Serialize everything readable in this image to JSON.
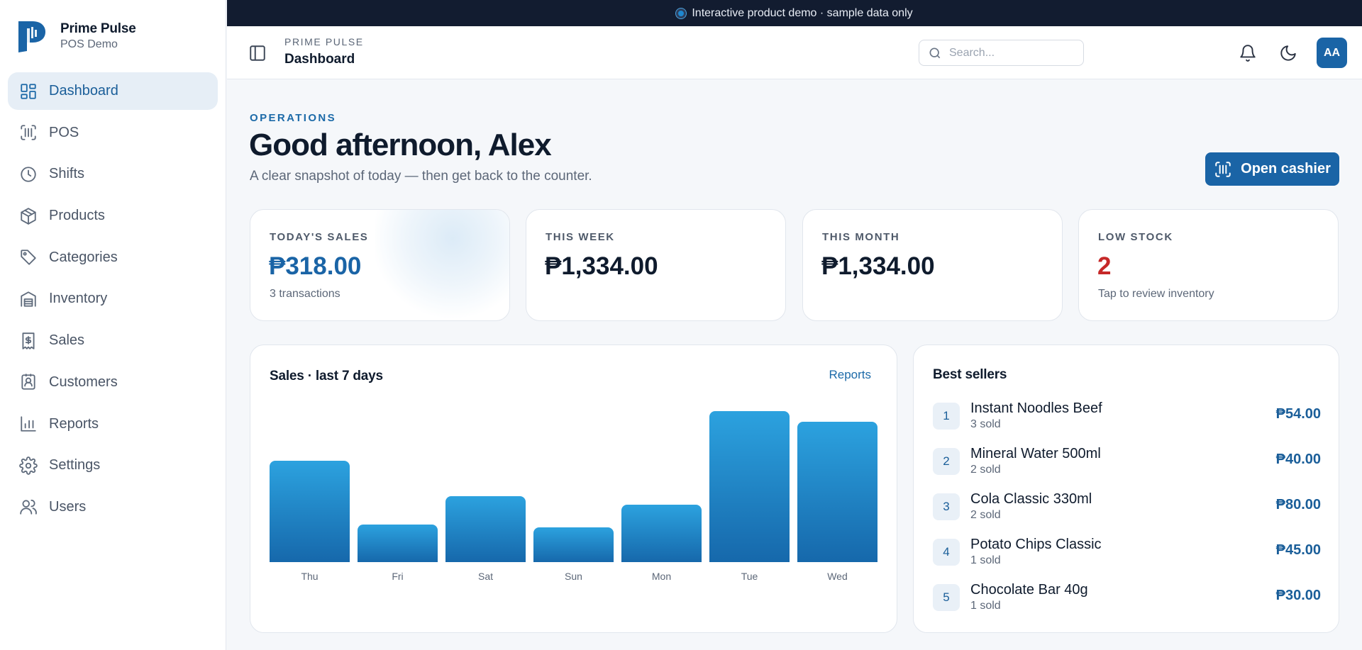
{
  "brand": {
    "name": "Prime Pulse",
    "subtitle": "POS Demo"
  },
  "nav": [
    {
      "label": "Dashboard",
      "icon": "dashboard-icon",
      "active": true
    },
    {
      "label": "POS",
      "icon": "barcode-scan-icon"
    },
    {
      "label": "Shifts",
      "icon": "clock-icon"
    },
    {
      "label": "Products",
      "icon": "box-icon"
    },
    {
      "label": "Categories",
      "icon": "tag-icon"
    },
    {
      "label": "Inventory",
      "icon": "warehouse-icon"
    },
    {
      "label": "Sales",
      "icon": "receipt-icon"
    },
    {
      "label": "Customers",
      "icon": "contact-icon"
    },
    {
      "label": "Reports",
      "icon": "bar-chart-icon"
    },
    {
      "label": "Settings",
      "icon": "gear-icon"
    },
    {
      "label": "Users",
      "icon": "users-icon"
    }
  ],
  "banner": {
    "text": "Interactive product demo · sample data only"
  },
  "topbar": {
    "breadcrumb": "PRIME PULSE",
    "page_title": "Dashboard",
    "search_placeholder": "Search...",
    "avatar_initials": "AA",
    "icons": [
      "sidebar-toggle-icon",
      "bell-icon",
      "moon-icon"
    ]
  },
  "header": {
    "eyebrow": "OPERATIONS",
    "greeting": "Good afternoon, Alex",
    "subtitle": "A clear snapshot of today — then get back to the counter.",
    "cta_label": "Open cashier"
  },
  "stats": [
    {
      "label": "TODAY'S SALES",
      "value": "₱318.00",
      "sub": "3 transactions",
      "accent": "#1a64a6"
    },
    {
      "label": "THIS WEEK",
      "value": "₱1,334.00",
      "sub": "",
      "accent": "#0f1b2d"
    },
    {
      "label": "THIS MONTH",
      "value": "₱1,334.00",
      "sub": "",
      "accent": "#0f1b2d"
    },
    {
      "label": "LOW STOCK",
      "value": "2",
      "sub": "Tap to review inventory",
      "accent": "#c62828"
    }
  ],
  "sales_panel": {
    "title": "Sales · last 7 days",
    "link": "Reports"
  },
  "chart_data": {
    "type": "bar",
    "title": "Sales · last 7 days",
    "categories": [
      "Thu",
      "Fri",
      "Sat",
      "Sun",
      "Mon",
      "Tue",
      "Wed"
    ],
    "values": [
      200,
      74,
      130,
      68,
      114,
      298,
      278
    ],
    "ylim": [
      0,
      300
    ],
    "grid": false,
    "xlabel": "",
    "ylabel": ""
  },
  "best_sellers": {
    "title": "Best sellers",
    "items": [
      {
        "rank": "1",
        "name": "Instant Noodles Beef",
        "sold": "3 sold",
        "amount": "₱54.00"
      },
      {
        "rank": "2",
        "name": "Mineral Water 500ml",
        "sold": "2 sold",
        "amount": "₱40.00"
      },
      {
        "rank": "3",
        "name": "Cola Classic 330ml",
        "sold": "2 sold",
        "amount": "₱80.00"
      },
      {
        "rank": "4",
        "name": "Potato Chips Classic",
        "sold": "1 sold",
        "amount": "₱45.00"
      },
      {
        "rank": "5",
        "name": "Chocolate Bar 40g",
        "sold": "1 sold",
        "amount": "₱30.00"
      }
    ]
  },
  "colors": {
    "primary": "#1a64a6",
    "danger": "#c62828",
    "banner": "#121c30"
  }
}
